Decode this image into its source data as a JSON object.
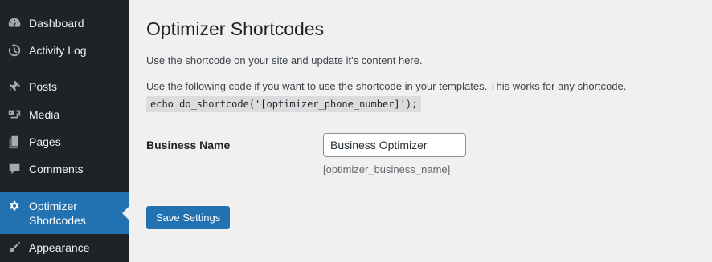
{
  "sidebar": {
    "items": [
      {
        "label": "Dashboard",
        "icon": "dashboard-icon"
      },
      {
        "label": "Activity Log",
        "icon": "history-icon"
      },
      {
        "label": "Posts",
        "icon": "pin-icon"
      },
      {
        "label": "Media",
        "icon": "media-icon"
      },
      {
        "label": "Pages",
        "icon": "pages-icon"
      },
      {
        "label": "Comments",
        "icon": "comment-icon"
      },
      {
        "label": "Optimizer Shortcodes",
        "icon": "gear-icon",
        "active": true
      },
      {
        "label": "Appearance",
        "icon": "brush-icon"
      }
    ],
    "active_color": "#2271b1",
    "background": "#1d2327"
  },
  "main": {
    "title": "Optimizer Shortcodes",
    "intro": "Use the shortcode on your site and update it's content here.",
    "template_note": "Use the following code if you want to use the shortcode in your templates. This works for any shortcode.",
    "code_example": "echo do_shortcode('[optimizer_phone_number]');",
    "fields": [
      {
        "label": "Business Name",
        "value": "Business Optimizer",
        "shortcode": "[optimizer_business_name]"
      }
    ],
    "save_label": "Save Settings"
  }
}
